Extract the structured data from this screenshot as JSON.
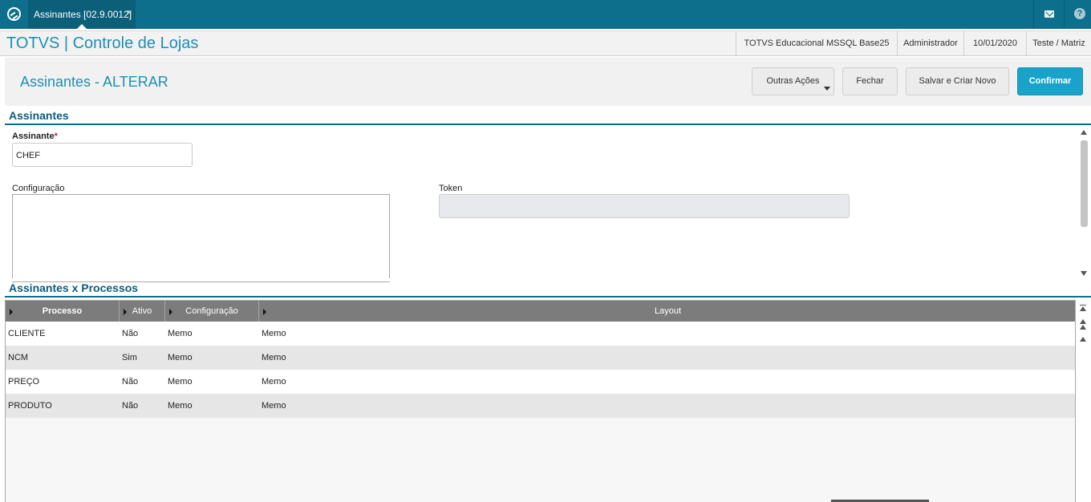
{
  "topbar": {
    "tab_label": "Assinantes [02.9.0012]",
    "tab_close": "×",
    "icons": [
      "logo-icon",
      "mail-icon",
      "help-icon"
    ],
    "help_glyph": "?"
  },
  "header": {
    "app_title": "TOTVS | Controle de Lojas",
    "environment": "TOTVS Educacional MSSQL Base25",
    "user": "Administrador",
    "date": "10/01/2020",
    "branch": "Teste / Matriz"
  },
  "page": {
    "title": "Assinantes - ALTERAR",
    "buttons": {
      "outras": "Outras Ações",
      "fechar": "Fechar",
      "salvar": "Salvar e Criar Novo",
      "confirmar": "Confirmar"
    }
  },
  "form": {
    "section_title": "Assinantes",
    "assinante_label": "Assinante",
    "required_mark": "*",
    "assinante_value": "CHEF",
    "configuracao_label": "Configuração",
    "configuracao_value": "",
    "token_label": "Token",
    "token_value": ""
  },
  "grid": {
    "section_title": "Assinantes x Processos",
    "columns": [
      "Processo",
      "Ativo",
      "Configuração",
      "Layout"
    ],
    "rows": [
      [
        "CLIENTE",
        "Não",
        "Memo",
        "Memo"
      ],
      [
        "NCM",
        "Sim",
        "Memo",
        "Memo"
      ],
      [
        "PREÇO",
        "Não",
        "Memo",
        "Memo"
      ],
      [
        "PRODUTO",
        "Não",
        "Memo",
        "Memo"
      ]
    ]
  },
  "colors": {
    "topbar": "#0d6f8c",
    "accent": "#1f8fb3",
    "confirm": "#1aa3c9",
    "grid_header": "#7c7c7c"
  }
}
